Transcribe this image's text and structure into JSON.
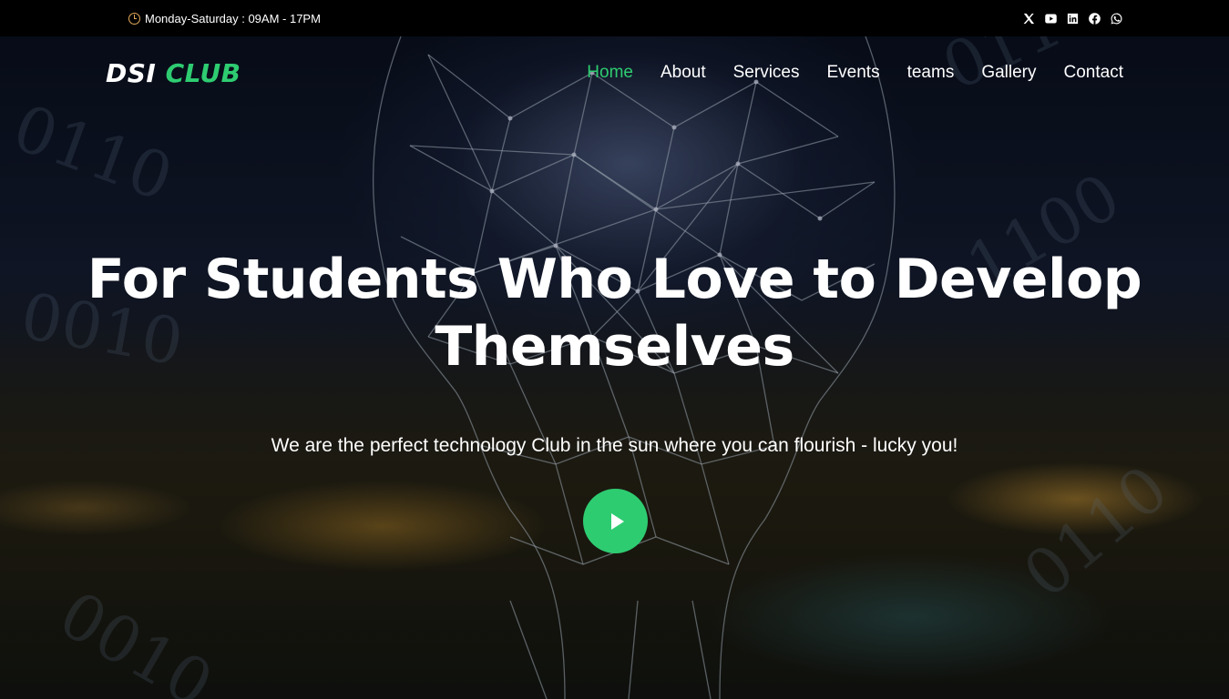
{
  "topbar": {
    "hours_text": "Monday-Saturday : 09AM - 17PM",
    "hours_icon": "clock-icon",
    "accent_color": "#e0a95a",
    "social_icons": [
      "x-twitter-icon",
      "youtube-icon",
      "linkedin-icon",
      "facebook-icon",
      "whatsapp-icon"
    ]
  },
  "nav": {
    "logo_part1": "DSI",
    "logo_part2": "CLUB",
    "items": [
      {
        "label": "Home",
        "active": true
      },
      {
        "label": "About"
      },
      {
        "label": "Services"
      },
      {
        "label": "Events"
      },
      {
        "label": "teams"
      },
      {
        "label": "Gallery"
      },
      {
        "label": "Contact"
      }
    ]
  },
  "hero": {
    "headline": "For Students Who Love to Develop Themselves",
    "tagline": "We are the perfect technology Club in the sun where you can flourish - lucky you!",
    "play_icon": "play-icon"
  },
  "colors": {
    "brand_green": "#2ecc71",
    "topbar_bg": "#000000",
    "text": "#ffffff"
  }
}
